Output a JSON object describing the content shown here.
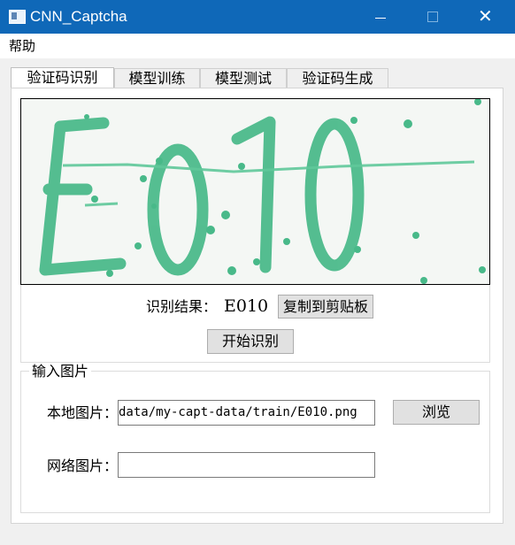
{
  "window": {
    "title": "CNN_Captcha",
    "titlebar_color": "#0f68b8",
    "minimize_icon": "minimize-icon",
    "maximize_icon": "maximize-icon",
    "close_icon": "close-icon",
    "close_glyph": "✕"
  },
  "menu": {
    "items": [
      "帮助"
    ]
  },
  "tabs": [
    {
      "label": "验证码识别",
      "active": true
    },
    {
      "label": "模型训练",
      "active": false
    },
    {
      "label": "模型测试",
      "active": false
    },
    {
      "label": "验证码生成",
      "active": false
    }
  ],
  "captcha": {
    "image_text": "E010",
    "glyph_color": "#48b989",
    "accent_color": "#2f9b70",
    "background": "#f4f7f4"
  },
  "recognition": {
    "result_label": "识别结果：",
    "result_value": "E010",
    "copy_button": "复制到剪贴板",
    "start_button": "开始识别"
  },
  "input_image": {
    "legend": "输入图片",
    "local_label": "本地图片：",
    "local_path": "data/my-capt-data/train/E010.png",
    "browse_button": "浏览",
    "web_label": "网络图片：",
    "web_url": ""
  }
}
